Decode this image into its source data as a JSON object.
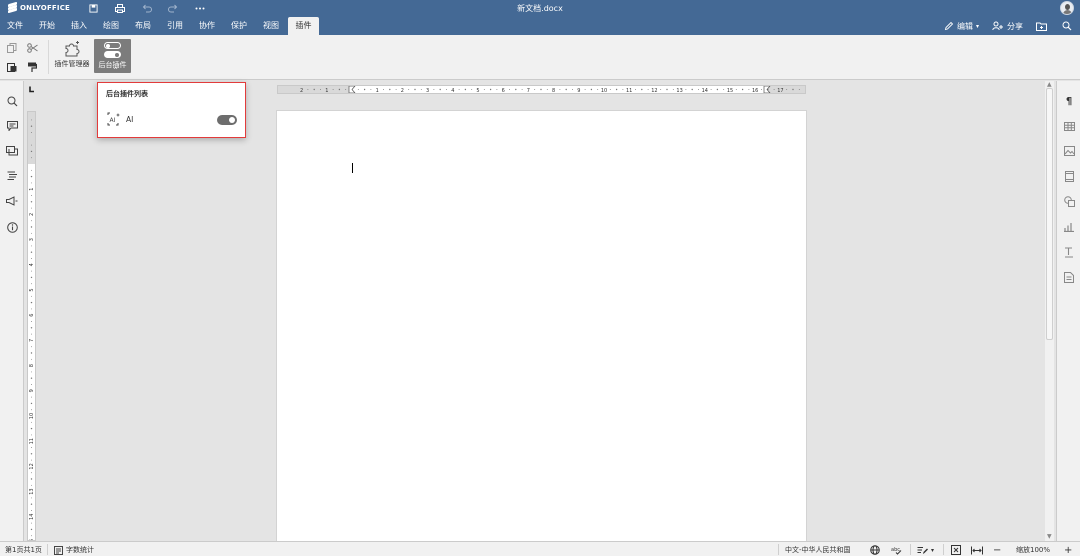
{
  "app": {
    "name": "ONLYOFFICE",
    "doc_title": "新文档.docx"
  },
  "menu": {
    "tabs": [
      {
        "label": "文件"
      },
      {
        "label": "开始"
      },
      {
        "label": "插入"
      },
      {
        "label": "绘图"
      },
      {
        "label": "布局"
      },
      {
        "label": "引用"
      },
      {
        "label": "协作"
      },
      {
        "label": "保护"
      },
      {
        "label": "视图"
      },
      {
        "label": "插件"
      }
    ],
    "active_tab": "插件",
    "edit_label": "编辑",
    "share_label": "分享"
  },
  "toolbar": {
    "plugin_manager_label": "插件管理器",
    "background_plugins_label": "后台插件"
  },
  "popup": {
    "title": "后台插件列表",
    "items": [
      {
        "label": "AI",
        "enabled": true
      }
    ]
  },
  "ruler": {
    "h_labels": [
      "2",
      "1",
      "1",
      "2",
      "3",
      "4",
      "5",
      "6",
      "7",
      "8",
      "9",
      "10",
      "11",
      "12",
      "13",
      "14",
      "15",
      "16",
      "17"
    ],
    "v_labels": [
      "1",
      "2",
      "3",
      "4",
      "5",
      "6",
      "7",
      "8",
      "9",
      "10",
      "11",
      "12",
      "13",
      "14",
      "15"
    ]
  },
  "status": {
    "page_info": "第1页共1页",
    "word_count": "字数统计",
    "language": "中文-中华人民共和国",
    "zoom": "缩放100%"
  },
  "colors": {
    "header": "#446995",
    "highlight_border": "#e23b3b",
    "toolbar_bg": "#f1f1f1"
  }
}
